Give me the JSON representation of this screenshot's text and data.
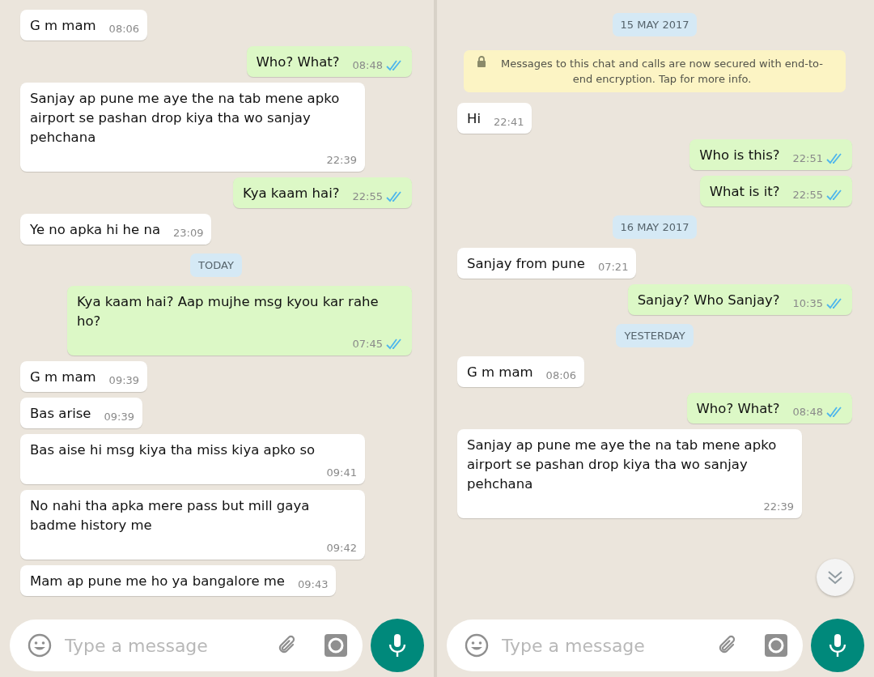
{
  "panels": [
    {
      "messages": [
        {
          "kind": "in",
          "text": "G m mam",
          "time": "08:06"
        },
        {
          "kind": "out",
          "text": "Who? What?",
          "time": "08:48",
          "read": true
        },
        {
          "kind": "in",
          "text": "Sanjay ap pune me aye the na tab mene apko airport se pashan drop kiya tha wo sanjay pehchana",
          "time": "22:39"
        },
        {
          "kind": "out",
          "text": "Kya kaam hai?",
          "time": "22:55",
          "read": true
        },
        {
          "kind": "in",
          "text": "Ye no apka hi he na",
          "time": "23:09"
        },
        {
          "kind": "date",
          "text": "TODAY"
        },
        {
          "kind": "out",
          "text": "Kya kaam hai? Aap mujhe msg kyou kar rahe ho?",
          "time": "07:45",
          "read": true
        },
        {
          "kind": "in",
          "text": "G m mam",
          "time": "09:39"
        },
        {
          "kind": "in",
          "text": "Bas arise",
          "time": "09:39"
        },
        {
          "kind": "in",
          "text": "Bas aise hi msg kiya tha miss kiya apko so",
          "time": "09:41"
        },
        {
          "kind": "in",
          "text": "No nahi tha apka mere pass but mill gaya badme history me",
          "time": "09:42"
        },
        {
          "kind": "in",
          "text": "Mam ap pune me ho ya bangalore me",
          "time": "09:43"
        }
      ],
      "input": {
        "placeholder": "Type a message"
      }
    },
    {
      "messages": [
        {
          "kind": "date",
          "text": "15 MAY 2017"
        },
        {
          "kind": "system",
          "text": "Messages to this chat and calls are now secured with end-to-end encryption. Tap for more info."
        },
        {
          "kind": "in",
          "text": "Hi",
          "time": "22:41"
        },
        {
          "kind": "out",
          "text": "Who is this?",
          "time": "22:51",
          "read": true
        },
        {
          "kind": "out",
          "text": "What is it?",
          "time": "22:55",
          "read": true
        },
        {
          "kind": "date",
          "text": "16 MAY 2017"
        },
        {
          "kind": "in",
          "text": "Sanjay from pune",
          "time": "07:21"
        },
        {
          "kind": "out",
          "text": "Sanjay? Who Sanjay?",
          "time": "10:35",
          "read": true
        },
        {
          "kind": "date",
          "text": "YESTERDAY"
        },
        {
          "kind": "in",
          "text": "G m mam",
          "time": "08:06"
        },
        {
          "kind": "out",
          "text": "Who? What?",
          "time": "08:48",
          "read": true
        },
        {
          "kind": "in",
          "text": "Sanjay ap pune me aye the na tab mene apko airport se pashan drop kiya tha wo sanjay pehchana",
          "time": "22:39"
        }
      ],
      "input": {
        "placeholder": "Type a message"
      }
    }
  ]
}
